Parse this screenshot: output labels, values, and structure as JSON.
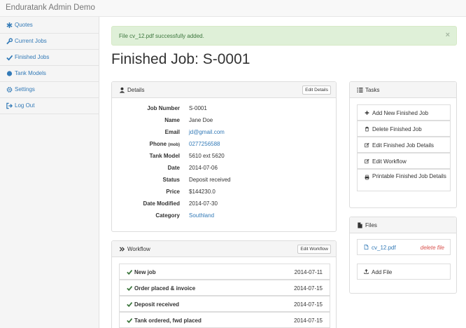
{
  "app": {
    "brand": "Enduratank Admin Demo"
  },
  "sidebar": {
    "items": [
      {
        "label": "Quotes",
        "icon": "asterisk-icon"
      },
      {
        "label": "Current Jobs",
        "icon": "wrench-icon"
      },
      {
        "label": "Finished Jobs",
        "icon": "check-icon"
      },
      {
        "label": "Tank Models",
        "icon": "circle-icon"
      },
      {
        "label": "Settings",
        "icon": "gear-icon"
      },
      {
        "label": "Log Out",
        "icon": "logout-icon"
      }
    ]
  },
  "alert": {
    "message": "File cv_12.pdf successfully added.",
    "close": "×"
  },
  "page": {
    "title": "Finished Job: S-0001"
  },
  "details": {
    "heading": "Details",
    "edit_label": "Edit Details",
    "fields": [
      {
        "key": "Job Number",
        "value": "S-0001"
      },
      {
        "key": "Name",
        "value": "Jane Doe"
      },
      {
        "key": "Email",
        "value": "jd@gmail.com"
      },
      {
        "key": "Phone",
        "key_suffix": "(mob)",
        "value": "0277256588"
      },
      {
        "key": "Tank Model",
        "value": "5610 ext 5620"
      },
      {
        "key": "Date",
        "value": "2014-07-06"
      },
      {
        "key": "Status",
        "value": "Deposit received"
      },
      {
        "key": "Price",
        "value": "$144230.0"
      },
      {
        "key": "Date Modified",
        "value": "2014-07-30"
      },
      {
        "key": "Category",
        "value": "Southland"
      }
    ]
  },
  "workflow": {
    "heading": "Workflow",
    "edit_label": "Edit Workflow",
    "items": [
      {
        "name": "New job",
        "date": "2014-07-11"
      },
      {
        "name": "Order placed & invoice",
        "date": "2014-07-15"
      },
      {
        "name": "Deposit received",
        "date": "2014-07-15"
      },
      {
        "name": "Tank ordered, fwd placed",
        "date": "2014-07-15"
      }
    ]
  },
  "tasks": {
    "heading": "Tasks",
    "items": [
      {
        "label": "Add New Finished Job",
        "icon": "plus-icon"
      },
      {
        "label": "Delete Finished Job",
        "icon": "trash-icon"
      },
      {
        "label": "Edit Finished Job Details",
        "icon": "edit-icon"
      },
      {
        "label": "Edit Workflow",
        "icon": "edit-icon"
      },
      {
        "label": "Printable Finished Job Details",
        "icon": "print-icon"
      }
    ]
  },
  "files": {
    "heading": "Files",
    "items": [
      {
        "name": "cv_12.pdf",
        "delete_label": "delete file"
      }
    ],
    "add_label": "Add File"
  },
  "colors": {
    "link": "#337ab7",
    "success_bg": "#dff0d8",
    "danger": "#d9534f",
    "check": "#3c763d"
  }
}
